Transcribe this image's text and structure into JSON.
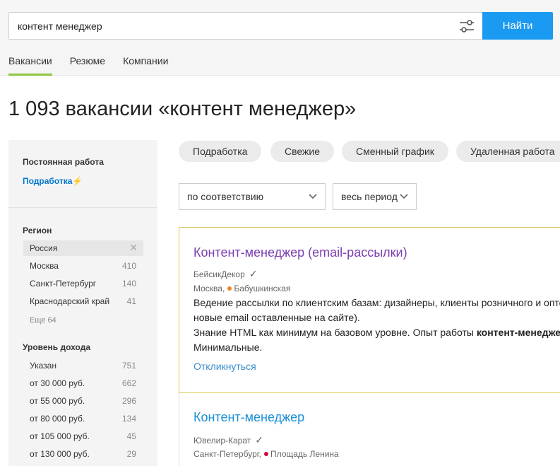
{
  "search": {
    "value": "контент менеджер",
    "find_label": "Найти"
  },
  "nav_tabs": [
    {
      "label": "Вакансии",
      "active": true
    },
    {
      "label": "Резюме",
      "active": false
    },
    {
      "label": "Компании",
      "active": false
    }
  ],
  "page_title": "1 093 вакансии «контент менеджер»",
  "sidebar": {
    "employment_header": "Постоянная работа",
    "employment_link": "Подработка",
    "region_header": "Регион",
    "regions": [
      {
        "label": "Россия",
        "count": "",
        "selected": true
      },
      {
        "label": "Москва",
        "count": "410"
      },
      {
        "label": "Санкт-Петербург",
        "count": "140"
      },
      {
        "label": "Краснодарский край",
        "count": "41"
      }
    ],
    "regions_more": "Еще 64",
    "income_header": "Уровень дохода",
    "income": [
      {
        "label": "Указан",
        "count": "751"
      },
      {
        "label": "от 30 000 руб.",
        "count": "662"
      },
      {
        "label": "от 55 000 руб.",
        "count": "296"
      },
      {
        "label": "от 80 000 руб.",
        "count": "134"
      },
      {
        "label": "от 105 000 руб.",
        "count": "45"
      },
      {
        "label": "от 130 000 руб.",
        "count": "29"
      }
    ]
  },
  "chips": [
    "Подработка",
    "Свежие",
    "Сменный график",
    "Удаленная работа"
  ],
  "sort": {
    "order": "по соответствию",
    "period": "весь период"
  },
  "vacancies": [
    {
      "title": "Контент-менеджер (email-рассылки)",
      "company": "БейсикДекор",
      "city": "Москва,",
      "metro": "Бабушкинская",
      "metro_color": "#f58220",
      "line1": "Ведение рассылки по клиентским базам: дизайнеры, клиенты розничного и опто",
      "line2": "новые email оставленные на сайте).",
      "line3_pre": "Знание HTML как минимум на базовом уровне. Опыт работы ",
      "line3_bold": "контент-менеджер",
      "line4": "Минимальные.",
      "respond": "Откликнуться",
      "title_color": "#7b3fb0"
    },
    {
      "title": "Контент-менеджер",
      "company": "Ювелир-Карат",
      "city": "Санкт-Петербург,",
      "metro": "Площадь Ленина",
      "metro_color": "#d6083b",
      "title_color": "#1a8fd6"
    }
  ],
  "colors": {
    "accent": "#1a9af0",
    "tab_underline": "#8dc63f",
    "card_border": "#e0c85a",
    "link": "#0077cc"
  }
}
